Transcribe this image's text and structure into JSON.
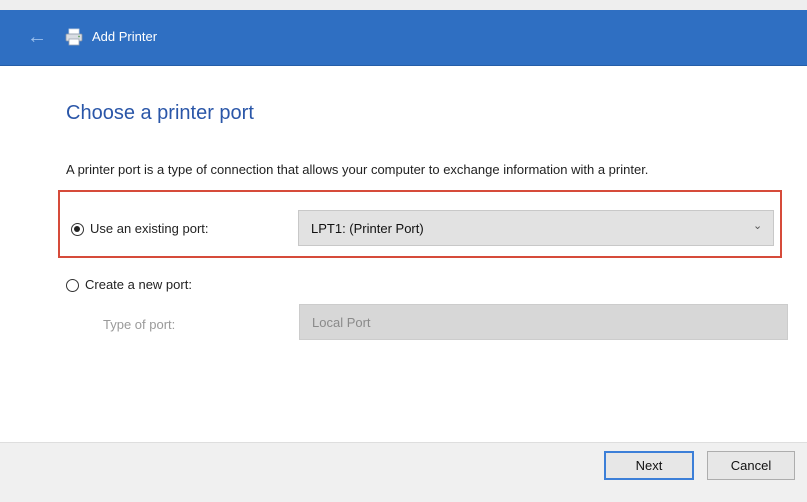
{
  "window": {
    "title": "Add Printer",
    "back_icon": "back-arrow-icon",
    "printer_icon": "printer-icon"
  },
  "main": {
    "heading": "Choose a printer port",
    "description": "A printer port is a type of connection that allows your computer to exchange information with a printer."
  },
  "existing_port": {
    "label": "Use an existing port:",
    "selected": true,
    "value": "LPT1: (Printer Port)"
  },
  "new_port": {
    "label": "Create a new port:",
    "selected": false,
    "type_label": "Type of port:",
    "type_value": "Local Port"
  },
  "buttons": {
    "next": "Next",
    "cancel": "Cancel"
  },
  "colors": {
    "titlebar": "#2f6fc2",
    "heading": "#2a56a8",
    "highlight_border": "#d64b3a"
  }
}
